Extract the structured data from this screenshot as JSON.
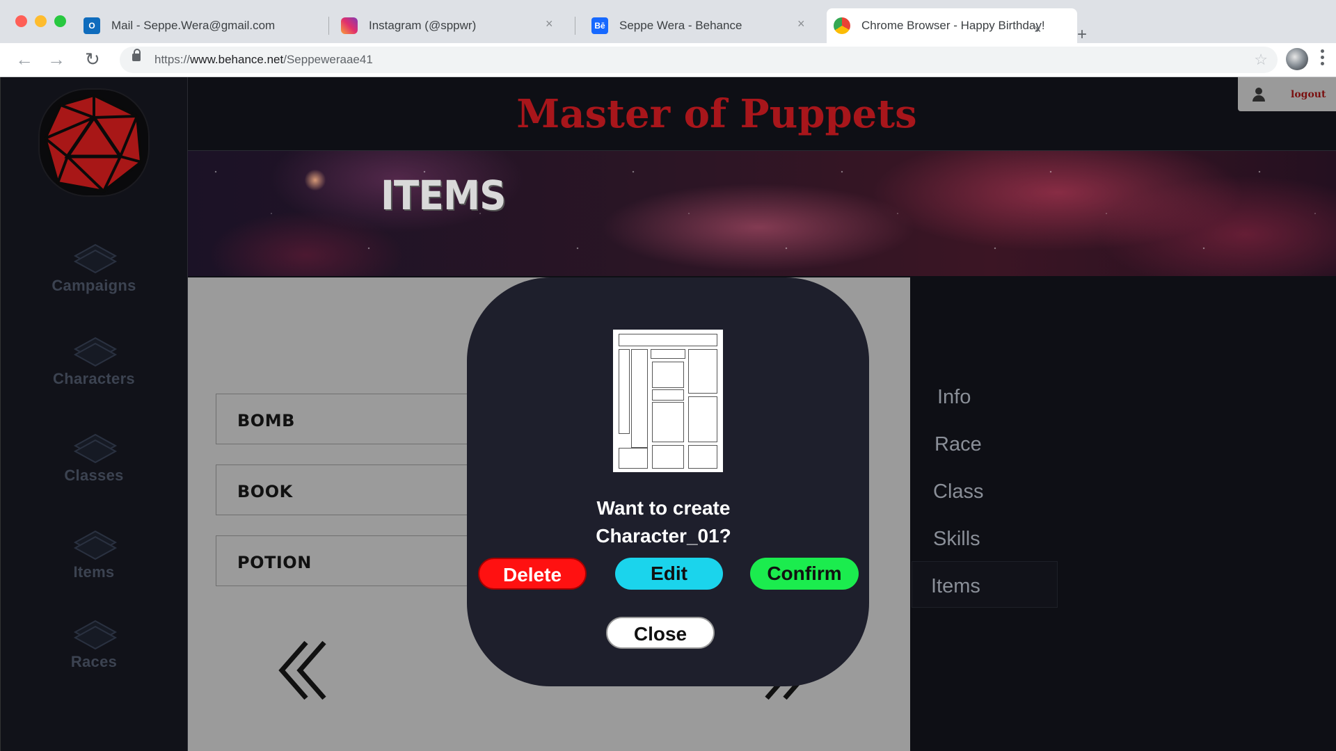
{
  "browser": {
    "tabs": [
      {
        "title": "Mail - Seppe.Wera@gmail.com",
        "icon": "outlook-icon"
      },
      {
        "title": "Instagram (@sppwr)",
        "icon": "instagram-icon"
      },
      {
        "title": "Seppe Wera - Behance",
        "icon": "behance-icon"
      },
      {
        "title": "Chrome Browser - Happy Birthday!",
        "icon": "chrome-icon",
        "active": true
      }
    ],
    "url_prefix": "https://",
    "url_host": "www.behance.net",
    "url_path": "/Seppeweraae41"
  },
  "app": {
    "title": "Master of Puppets",
    "logout_label": "logout",
    "banner_title": "ITEMS",
    "nav": [
      {
        "label": "Campaigns"
      },
      {
        "label": "Characters"
      },
      {
        "label": "Classes"
      },
      {
        "label": "Items"
      },
      {
        "label": "Races"
      }
    ],
    "items": [
      {
        "name": "BOMB"
      },
      {
        "name": "BOOK"
      },
      {
        "name": "POTION"
      }
    ],
    "right_menu": [
      {
        "label": "Info"
      },
      {
        "label": "Race"
      },
      {
        "label": "Class"
      },
      {
        "label": "Skills"
      },
      {
        "label": "Items",
        "selected": true
      }
    ],
    "colors": {
      "title_red": "#a8161b",
      "delete_red": "#ff1111",
      "edit_cyan": "#1bd4ec",
      "confirm_green": "#1bec4e"
    }
  },
  "modal": {
    "question_line1": "Want to create",
    "question_line2": "Character_01?",
    "delete_label": "Delete",
    "edit_label": "Edit",
    "confirm_label": "Confirm",
    "close_label": "Close"
  }
}
